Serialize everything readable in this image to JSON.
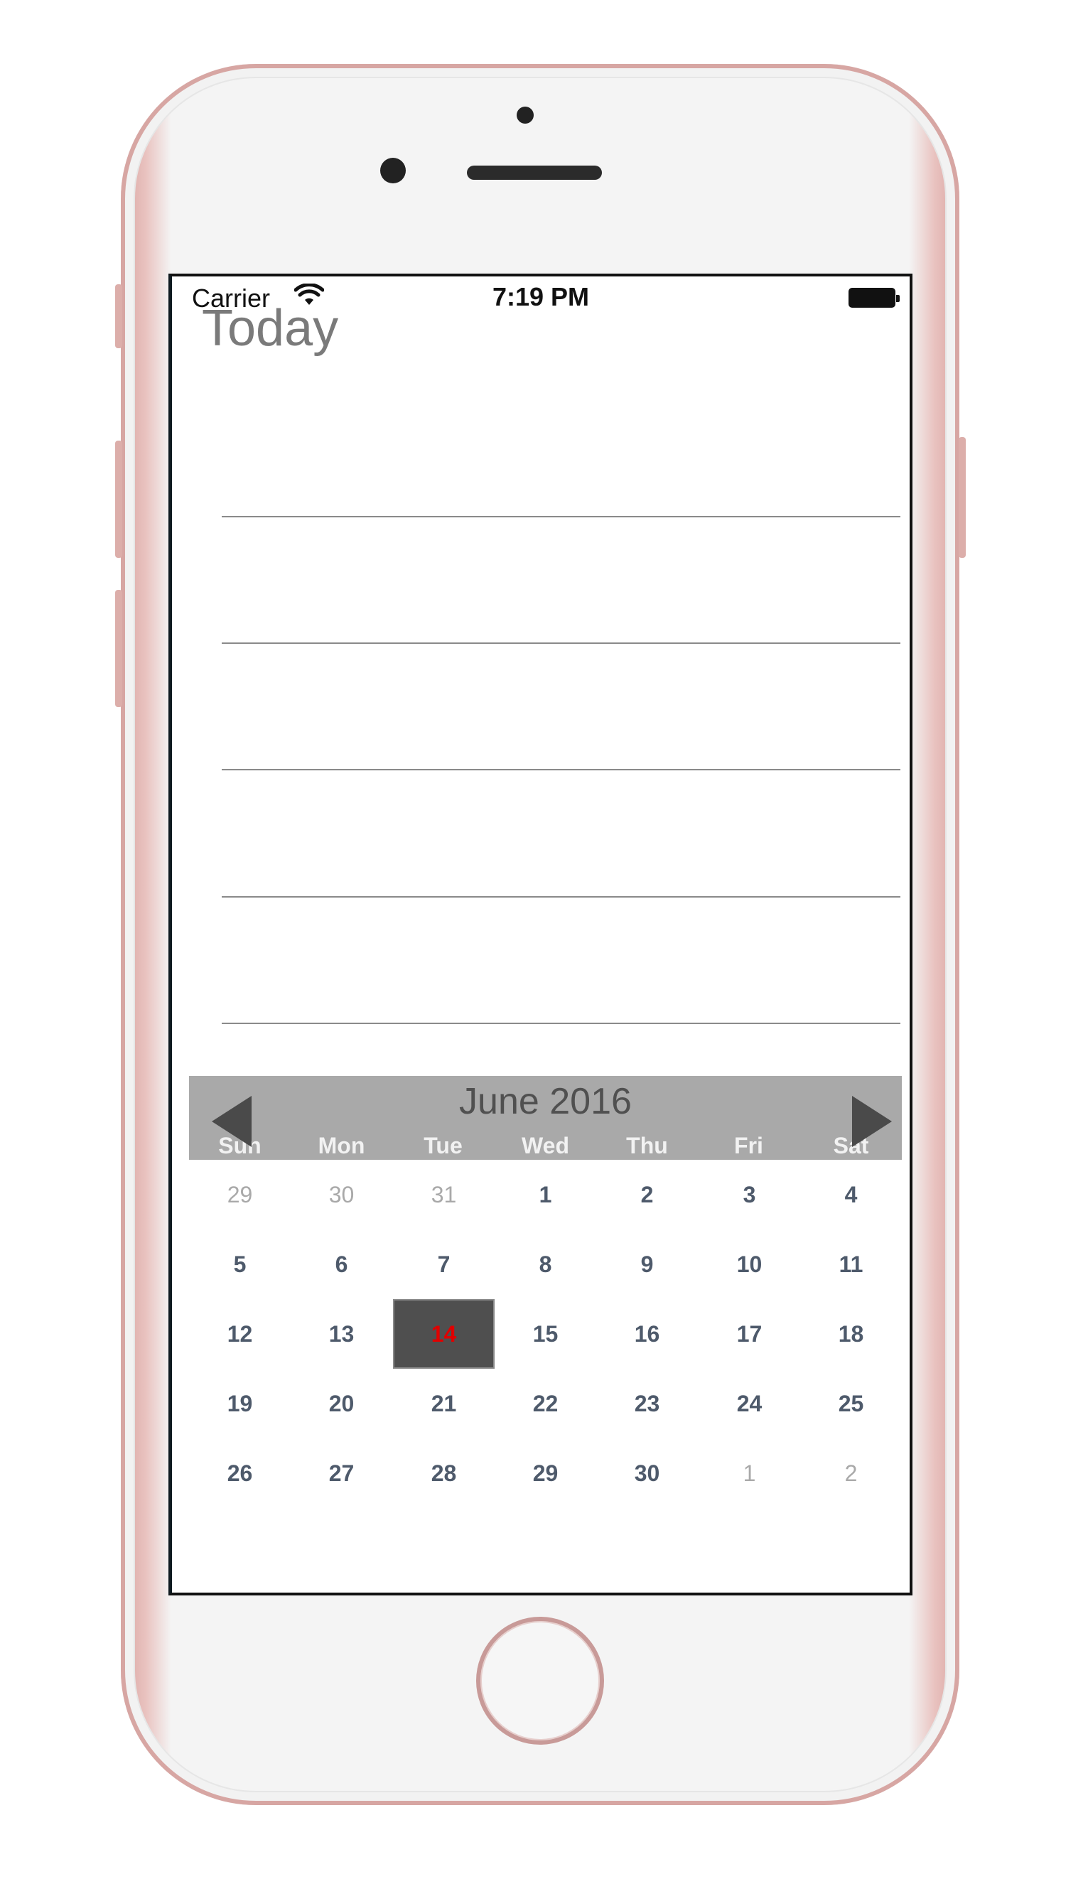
{
  "status": {
    "carrier": "Carrier",
    "time": "7:19 PM"
  },
  "page": {
    "title": "Today"
  },
  "calendar": {
    "month_label": "June 2016",
    "weekdays": [
      "Sun",
      "Mon",
      "Tue",
      "Wed",
      "Thu",
      "Fri",
      "Sat"
    ],
    "weeks": [
      [
        {
          "d": "29",
          "o": true
        },
        {
          "d": "30",
          "o": true
        },
        {
          "d": "31",
          "o": true
        },
        {
          "d": "1"
        },
        {
          "d": "2"
        },
        {
          "d": "3"
        },
        {
          "d": "4"
        }
      ],
      [
        {
          "d": "5"
        },
        {
          "d": "6"
        },
        {
          "d": "7"
        },
        {
          "d": "8"
        },
        {
          "d": "9"
        },
        {
          "d": "10"
        },
        {
          "d": "11"
        }
      ],
      [
        {
          "d": "12"
        },
        {
          "d": "13"
        },
        {
          "d": "14",
          "sel": true
        },
        {
          "d": "15"
        },
        {
          "d": "16"
        },
        {
          "d": "17"
        },
        {
          "d": "18"
        }
      ],
      [
        {
          "d": "19"
        },
        {
          "d": "20"
        },
        {
          "d": "21"
        },
        {
          "d": "22"
        },
        {
          "d": "23"
        },
        {
          "d": "24"
        },
        {
          "d": "25"
        }
      ],
      [
        {
          "d": "26"
        },
        {
          "d": "27"
        },
        {
          "d": "28"
        },
        {
          "d": "29"
        },
        {
          "d": "30"
        },
        {
          "d": "1",
          "o": true
        },
        {
          "d": "2",
          "o": true
        }
      ]
    ],
    "selected_day": "14",
    "colors": {
      "header_bg": "#a9a9a9",
      "selected_bg": "#4f4f4f",
      "selected_text": "#e00000"
    }
  },
  "icons": {
    "prev": "triangle-left-icon",
    "next": "triangle-right-icon",
    "wifi": "wifi-icon",
    "battery": "battery-icon"
  }
}
